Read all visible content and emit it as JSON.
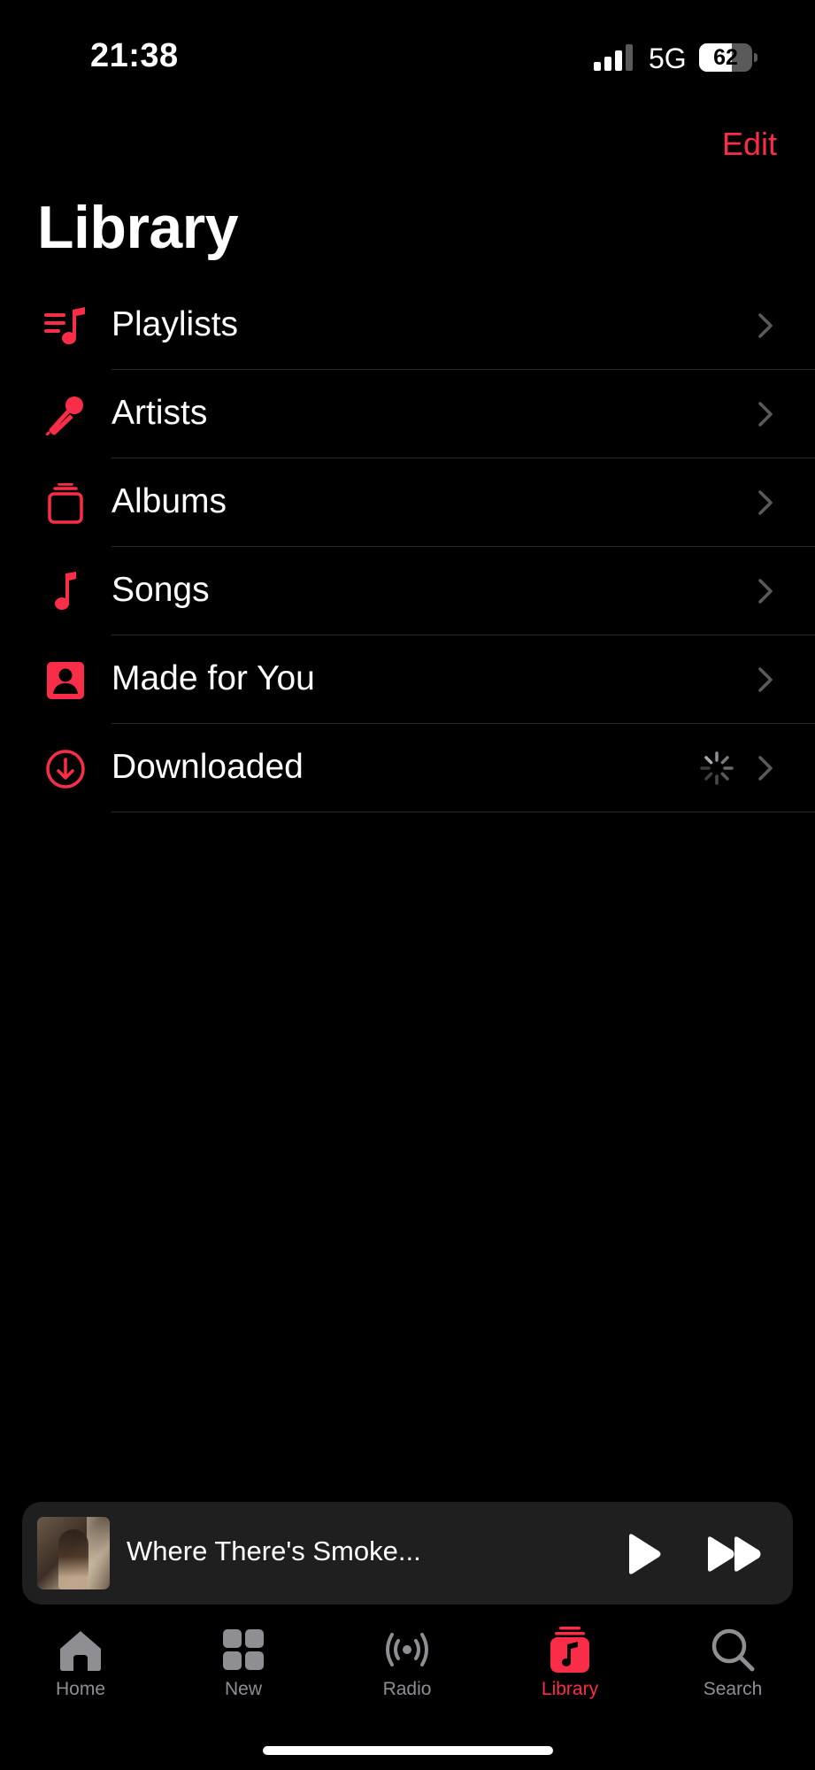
{
  "status_bar": {
    "time": "21:38",
    "network": "5G",
    "battery_level": "62",
    "battery_fraction": 0.62,
    "signal_bars_active": 3
  },
  "header": {
    "edit_label": "Edit",
    "title": "Library"
  },
  "library_items": [
    {
      "label": "Playlists",
      "icon": "playlists-icon"
    },
    {
      "label": "Artists",
      "icon": "microphone-icon"
    },
    {
      "label": "Albums",
      "icon": "albums-icon"
    },
    {
      "label": "Songs",
      "icon": "music-note-icon"
    },
    {
      "label": "Made for You",
      "icon": "person-square-icon"
    },
    {
      "label": "Downloaded",
      "icon": "download-icon",
      "loading": true
    }
  ],
  "now_playing": {
    "title": "Where There's Smoke..."
  },
  "tab_bar": {
    "tabs": [
      {
        "label": "Home",
        "icon": "home-icon"
      },
      {
        "label": "New",
        "icon": "grid-icon"
      },
      {
        "label": "Radio",
        "icon": "radio-icon"
      },
      {
        "label": "Library",
        "icon": "library-icon",
        "active": true
      },
      {
        "label": "Search",
        "icon": "search-icon"
      }
    ]
  },
  "colors": {
    "accent": "#fa2d48",
    "background": "#000000",
    "inactive": "#8e8e93",
    "player_background": "#1f1f1f"
  }
}
